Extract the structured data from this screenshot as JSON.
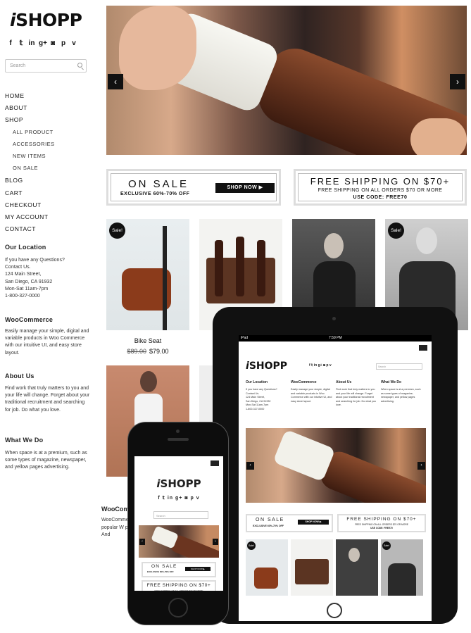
{
  "site": {
    "logo_prefix": "i",
    "logo_main": "SHOPP"
  },
  "social_icons": [
    "facebook-icon",
    "twitter-icon",
    "linkedin-icon",
    "googleplus-icon",
    "instagram-icon",
    "pinterest-icon",
    "vimeo-icon"
  ],
  "search": {
    "placeholder": "Search"
  },
  "nav": [
    {
      "label": "HOME",
      "sub": false
    },
    {
      "label": "ABOUT",
      "sub": false
    },
    {
      "label": "SHOP",
      "sub": false
    },
    {
      "label": "ALL PRODUCT",
      "sub": true
    },
    {
      "label": "ACCESSORIES",
      "sub": true
    },
    {
      "label": "NEW ITEMS",
      "sub": true
    },
    {
      "label": "ON SALE",
      "sub": true
    },
    {
      "label": "BLOG",
      "sub": false
    },
    {
      "label": "CART",
      "sub": false
    },
    {
      "label": "CHECKOUT",
      "sub": false
    },
    {
      "label": "MY ACCOUNT",
      "sub": false
    },
    {
      "label": "CONTACT",
      "sub": false
    }
  ],
  "location": {
    "title": "Our Location",
    "lines": [
      "If you have any Questions?",
      "Contact Us.",
      "124 Main Street,",
      "San Diego, CA 91932",
      "Mon-Sat 11am-7pm",
      "1-800-327-0000"
    ]
  },
  "woocommerce": {
    "title": "WooCommerce",
    "text": "Easily manage your simple, digital and variable products in Woo Commerce with our intuitive UI, and easy store layout."
  },
  "about": {
    "title": "About Us",
    "text": "Find work that truly matters to you and your life will change. Forget about your traditional recruitment and searching for job. Do what you love."
  },
  "whatwedo": {
    "title": "What We Do",
    "text": "When space is at a premium, such as some types of magazine, newspaper, and yellow pages advertising."
  },
  "banners": {
    "sale_title": "ON SALE",
    "sale_sub": "EXCLUSIVE 60%-70% OFF",
    "shop_now": "SHOP NOW ▶",
    "shipping_title": "FREE SHIPPING ON $70+",
    "shipping_sub": "FREE SHIPPING ON ALL ORDERS $70 OR MORE",
    "shipping_code": "USE CODE: FREE70"
  },
  "sale_badge": "Sale!",
  "product": {
    "name": "Bike Seat",
    "old_price": "$89.00",
    "price": "$79.00"
  },
  "footer_partial": {
    "title": "WooComm",
    "text": "WooComme popular W plugin. And"
  },
  "tablet": {
    "carrier": "iPad",
    "time": "7:59 PM"
  }
}
